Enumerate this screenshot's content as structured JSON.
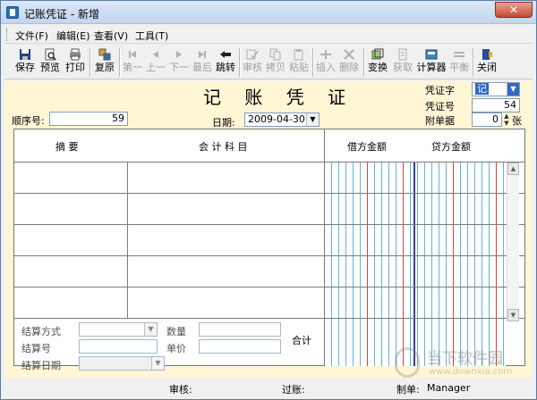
{
  "window": {
    "title": "记账凭证 - 新增",
    "close_label": "✕"
  },
  "menu": [
    {
      "label": "文件(F)"
    },
    {
      "label": "编辑(E)"
    },
    {
      "label": "查看(V)"
    },
    {
      "label": "工具(T)"
    }
  ],
  "toolbar": [
    {
      "label": "保存",
      "icon": "save-icon",
      "enabled": true
    },
    {
      "label": "预览",
      "icon": "preview-icon",
      "enabled": true
    },
    {
      "label": "打印",
      "icon": "print-icon",
      "enabled": true
    },
    {
      "label": "复原",
      "icon": "restore-icon",
      "enabled": true
    },
    {
      "label": "第一",
      "icon": "first-icon",
      "enabled": false
    },
    {
      "label": "上一",
      "icon": "previous-icon",
      "enabled": false
    },
    {
      "label": "下一",
      "icon": "next-icon",
      "enabled": false
    },
    {
      "label": "最后",
      "icon": "last-icon",
      "enabled": false
    },
    {
      "label": "跳转",
      "icon": "jump-icon",
      "enabled": true
    },
    {
      "label": "审核",
      "icon": "audit-icon",
      "enabled": false
    },
    {
      "label": "拷贝",
      "icon": "copy-icon",
      "enabled": false
    },
    {
      "label": "粘贴",
      "icon": "paste-icon",
      "enabled": false
    },
    {
      "label": "插入",
      "icon": "insert-icon",
      "enabled": false
    },
    {
      "label": "删除",
      "icon": "delete-icon",
      "enabled": false
    },
    {
      "label": "变换",
      "icon": "transform-icon",
      "enabled": true
    },
    {
      "label": "获取",
      "icon": "fetch-icon",
      "enabled": false
    },
    {
      "label": "计算器",
      "icon": "calculator-icon",
      "enabled": true
    },
    {
      "label": "平衡",
      "icon": "balance-icon",
      "enabled": false
    },
    {
      "label": "关闭",
      "icon": "close-door-icon",
      "enabled": true
    }
  ],
  "voucher": {
    "title": "记 账 凭 证",
    "seq_label": "顺序号:",
    "seq_value": "59",
    "date_label": "日期:",
    "date_value": "2009-04-30",
    "type_label": "凭证字",
    "type_value": "记",
    "number_label": "凭证号",
    "number_value": "54",
    "attach_label": "附单据",
    "attach_value": "0",
    "attach_unit": "张"
  },
  "grid": {
    "col_summary": "摘  要",
    "col_account": "会 计 科 目",
    "col_debit": "借方金额",
    "col_credit": "贷方金额",
    "rows": 5
  },
  "settlement": {
    "method_label": "结算方式",
    "number_label": "结算号",
    "date_label": "结算日期",
    "qty_label": "数量",
    "price_label": "单价",
    "total_label": "合计"
  },
  "status": {
    "audit_label": "审核:",
    "post_label": "过账:",
    "maker_label": "制单:",
    "maker_value": "Manager"
  },
  "watermark": {
    "text": "当下软件园",
    "url": "www.downxia.com"
  },
  "colors": {
    "form_bg": "#fff6d6",
    "grid_cyan": "#5db6d9",
    "grid_red": "#e04040",
    "selection": "#3169c6"
  }
}
